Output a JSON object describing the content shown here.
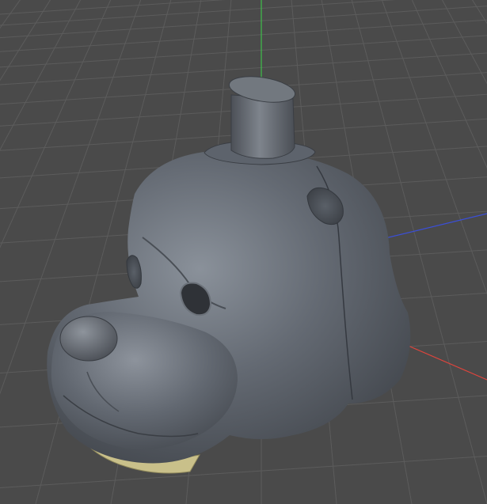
{
  "viewport": {
    "background_color": "#4a4a4a",
    "grid": true,
    "grid_color": "#5c5c5c",
    "axis_colors": {
      "x": "#e0443c",
      "y": "#3fbf4a",
      "z": "#3b4fd8"
    }
  },
  "model": {
    "name": "bear-head-with-top-hat",
    "body_color": "#5d636c",
    "teeth_color": "#c9c08a",
    "parts": [
      "top-hat",
      "head",
      "left-ear",
      "right-ear",
      "left-eye-socket",
      "right-eye-socket",
      "snout",
      "nose",
      "teeth"
    ]
  }
}
